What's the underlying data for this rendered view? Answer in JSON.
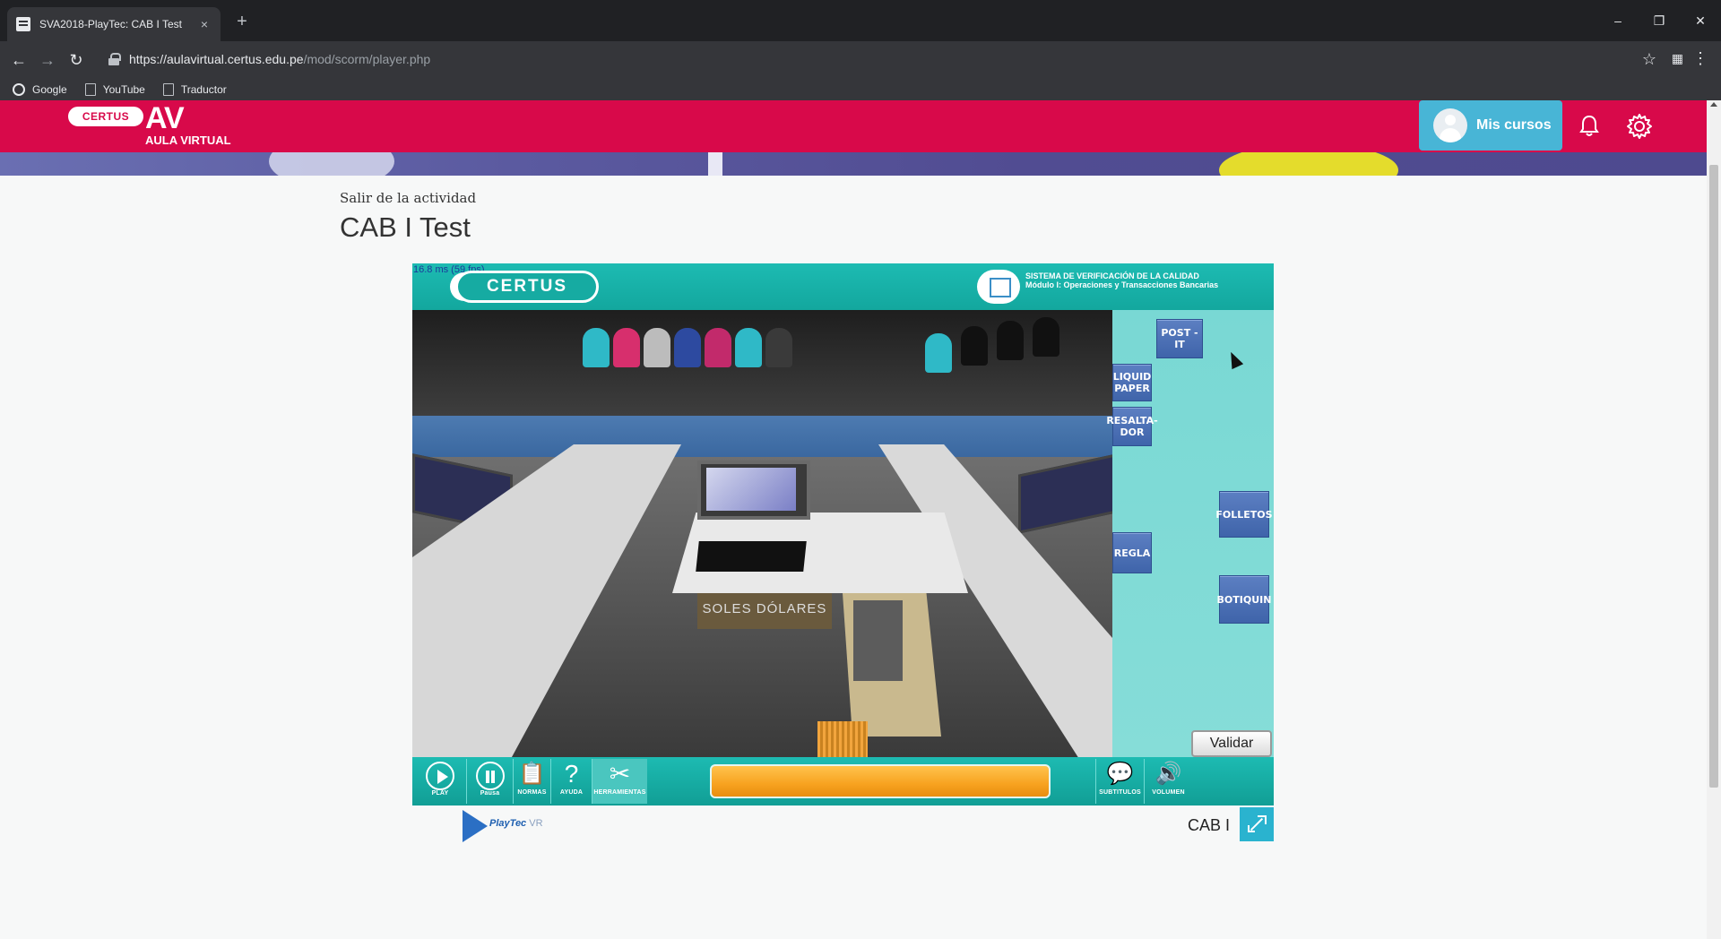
{
  "browser": {
    "tab_title": "SVA2018-PlayTec: CAB I Test",
    "tab_close": "×",
    "new_tab": "+",
    "url_host": "https://aulavirtual.certus.edu.pe",
    "url_path": "/mod/scorm/player.php",
    "window_controls": {
      "minimize": "–",
      "maximize": "❐",
      "close": "✕"
    },
    "nav": {
      "back": "←",
      "forward": "→",
      "reload": "↻"
    },
    "bookmark_star": "☆",
    "menu": "⋮",
    "bookmarks": [
      "Google",
      "YouTube",
      "Traductor"
    ]
  },
  "site_header": {
    "logo_pill": "CERTUS",
    "logo_av": "AV",
    "logo_sub": "AULA VIRTUAL",
    "mis_cursos_label": "Mis cursos",
    "brand_color": "#d8094a",
    "accent_color": "#48b5d6"
  },
  "activity": {
    "exit_link": "Salir de la actividad",
    "title": "CAB I Test"
  },
  "player": {
    "fps": "16.8 ms (59 fps)",
    "certus_logo": "CERTUS",
    "system_title": "SISTEMA DE VERIFICACIÓN DE LA CALIDAD",
    "system_module": "Módulo I: Operaciones y Transacciones Bancarias",
    "scene_sign": "SOLES  DÓLARES",
    "tools": {
      "post_it": "POST - IT",
      "liquid_paper": "LIQUID PAPER",
      "resaltador": "RESALTA- DOR",
      "folletos": "FOLLETOS",
      "regla": "REGLA",
      "botiquin": "BOTIQUIN"
    },
    "validar": "Validar",
    "controls": {
      "play": "PLAY",
      "pausa": "Pausa",
      "normas": "NORMAS",
      "ayuda": "AYUDA",
      "herramientas": "HERRAMIENTAS",
      "subtitulos": "SUBTITULOS",
      "volumen": "VOLUMEN"
    },
    "icons": {
      "normas": "📋",
      "ayuda": "?",
      "herramientas": "✂",
      "subtitulos": "💬",
      "volumen": "🔊"
    }
  },
  "footer": {
    "playtec_name": "PlayTec",
    "playtec_vr": "VR",
    "cab_label": "CAB I"
  }
}
